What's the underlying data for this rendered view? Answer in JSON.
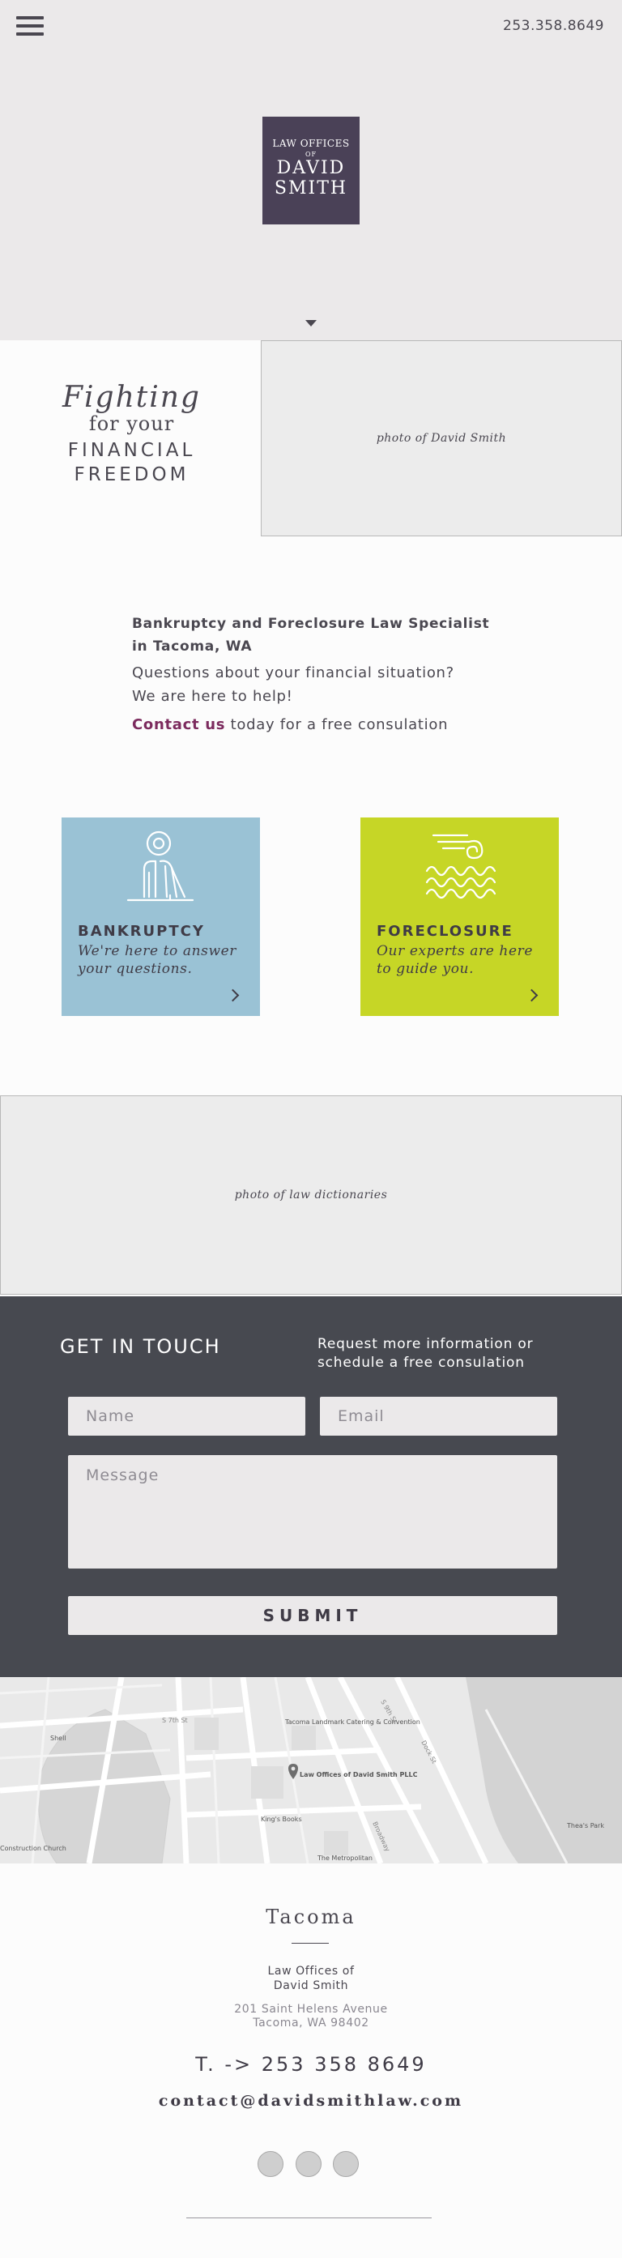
{
  "header": {
    "phone": "253.358.8649",
    "logo": {
      "line1": "LAW OFFICES",
      "line2": "OF",
      "line3": "DAVID",
      "line4": "SMITH"
    }
  },
  "hero_tagline": {
    "line1": "Fighting",
    "line2": "for your",
    "line3": "FINANCIAL",
    "line4": "FREEDOM"
  },
  "photos": {
    "david": "photo of David Smith",
    "dictionaries": "photo of law dictionaries"
  },
  "intro": {
    "heading_line1": "Bankruptcy and Foreclosure Law Specialist",
    "heading_line2": "in Tacoma, WA",
    "question_line1": "Questions about your financial situation?",
    "question_line2": "We are here to help!",
    "contact_link": "Contact us",
    "contact_rest": " today for a free consulation"
  },
  "services": [
    {
      "title": "BANKRUPTCY",
      "description": "We're here to answer your questions.",
      "color": "#9ac2d5",
      "icon": "person-in-chair-icon"
    },
    {
      "title": "FORECLOSURE",
      "description": "Our experts are here to guide you.",
      "color": "#c6d626",
      "icon": "waves-wind-icon"
    }
  ],
  "contact_form": {
    "title": "GET IN TOUCH",
    "subtitle": "Request more information or schedule a free consulation",
    "name_placeholder": "Name",
    "email_placeholder": "Email",
    "message_placeholder": "Message",
    "submit_label": "SUBMIT"
  },
  "map": {
    "labels": {
      "shell": "Shell",
      "church": "Construction Church",
      "landmark": "Tacoma Landmark Catering & Convention",
      "office": "Law Offices of David Smith PLLC",
      "books": "King's Books",
      "metropolitan": "The Metropolitan",
      "park": "Thea's Park",
      "street1": "S 7th St",
      "street2": "S 9th St",
      "street3": "Dock St",
      "street4": "Broadway"
    }
  },
  "footer": {
    "city": "Tacoma",
    "office_line1": "Law Offices of",
    "office_line2": "David Smith",
    "address_line1": "201 Saint Helens Avenue",
    "address_line2": "Tacoma, WA 98402",
    "phone": "T. -> 253 358 8649",
    "email": "contact@davidsmithlaw.com"
  },
  "colors": {
    "brand_purple": "#4a4157",
    "accent_link": "#7c2b5e",
    "bankruptcy_blue": "#9ac2d5",
    "foreclosure_green": "#c6d626",
    "contact_bg": "#474950"
  }
}
